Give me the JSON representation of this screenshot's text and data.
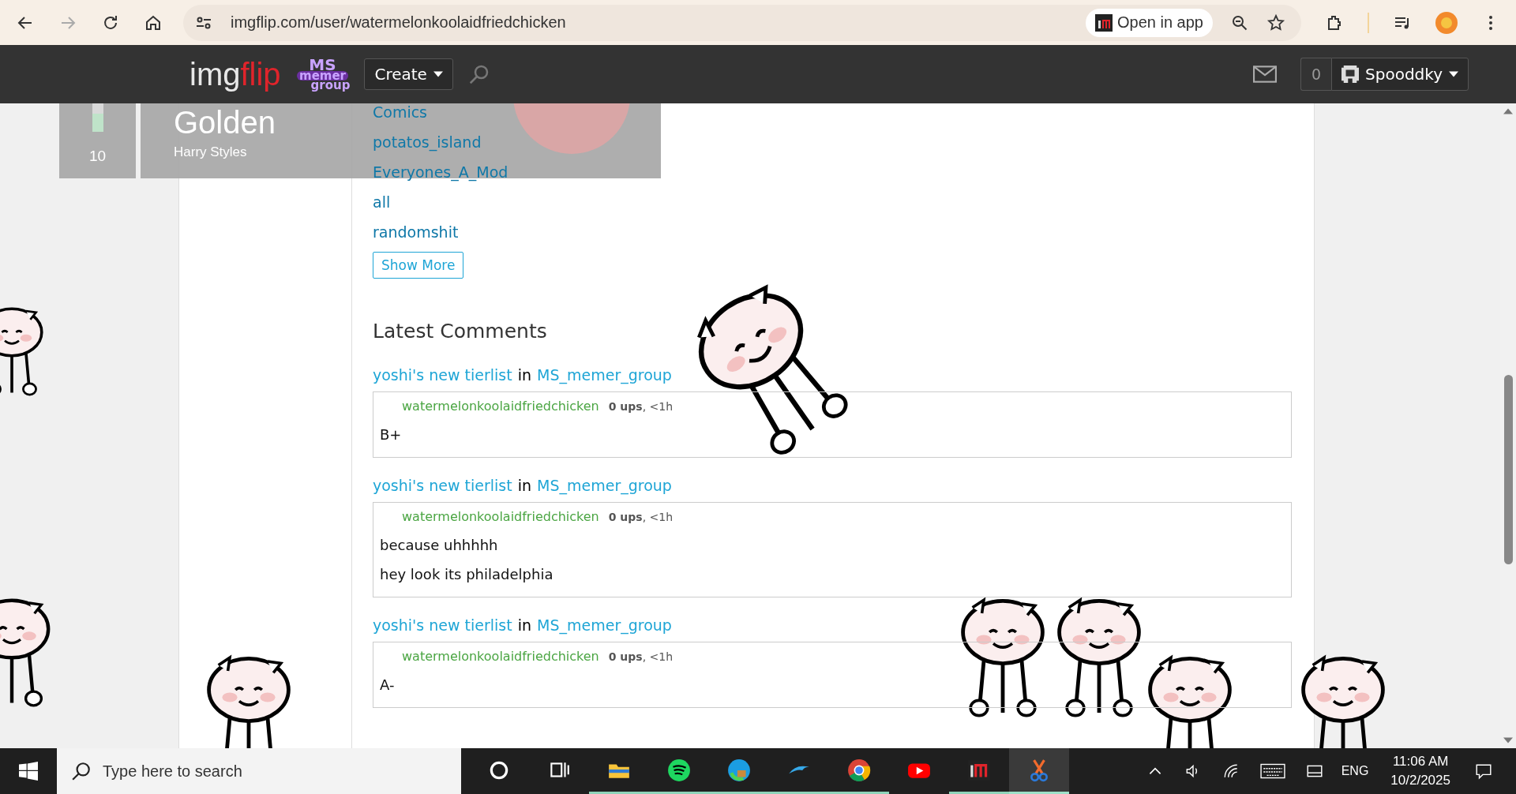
{
  "browser": {
    "url": "imgflip.com/user/watermelonkoolaidfriedchicken",
    "open_in_app": "Open in app"
  },
  "nav": {
    "logo_img": "img",
    "logo_flip": "flip",
    "group_logo": [
      "MS",
      "memer",
      "group"
    ],
    "create": "Create",
    "notification_count": "0",
    "username": "Spooddky"
  },
  "media_overlay": {
    "volume": "10",
    "level": 0.2,
    "title": "Golden",
    "artist": "Harry Styles"
  },
  "sidebar_links": [
    "Comics",
    "potatos_island",
    "Everyones_A_Mod",
    "all",
    "randomshit"
  ],
  "show_more": "Show More",
  "latest_comments": {
    "heading": "Latest Comments",
    "comments": [
      {
        "post": "yoshi's new tierlist",
        "in": "in",
        "group": "MS_memer_group",
        "user": "watermelonkoolaidfriedchicken",
        "meta": "**0 ups**, <1h",
        "lines": [
          "B+"
        ]
      },
      {
        "post": "yoshi's new tierlist",
        "in": "in",
        "group": "MS_memer_group",
        "user": "watermelonkoolaidfriedchicken",
        "meta": "**0 ups**, <1h",
        "lines": [
          "because uhhhhh",
          "hey look its philadelphia"
        ]
      },
      {
        "post": "yoshi's new tierlist",
        "in": "in",
        "group": "MS_memer_group",
        "user": "watermelonkoolaidfriedchicken",
        "meta": "**0 ups**, <1h",
        "lines": [
          "A-"
        ]
      }
    ]
  },
  "taskbar": {
    "search_placeholder": "Type here to search",
    "apps": [
      {
        "kind": "cortana",
        "running": false,
        "selected": false
      },
      {
        "kind": "task-view",
        "running": false,
        "selected": false
      },
      {
        "kind": "files",
        "running": true,
        "selected": false
      },
      {
        "kind": "spotify",
        "running": true,
        "selected": false
      },
      {
        "kind": "edge",
        "running": true,
        "selected": false
      },
      {
        "kind": "dolphin",
        "running": true,
        "selected": false
      },
      {
        "kind": "chrome",
        "running": true,
        "selected": false
      },
      {
        "kind": "youtube",
        "running": false,
        "selected": false
      },
      {
        "kind": "imgflip",
        "running": true,
        "selected": false
      },
      {
        "kind": "snipping",
        "running": true,
        "selected": true
      }
    ],
    "language": "ENG",
    "time": "11:06 AM",
    "date": "10/2/2025"
  }
}
